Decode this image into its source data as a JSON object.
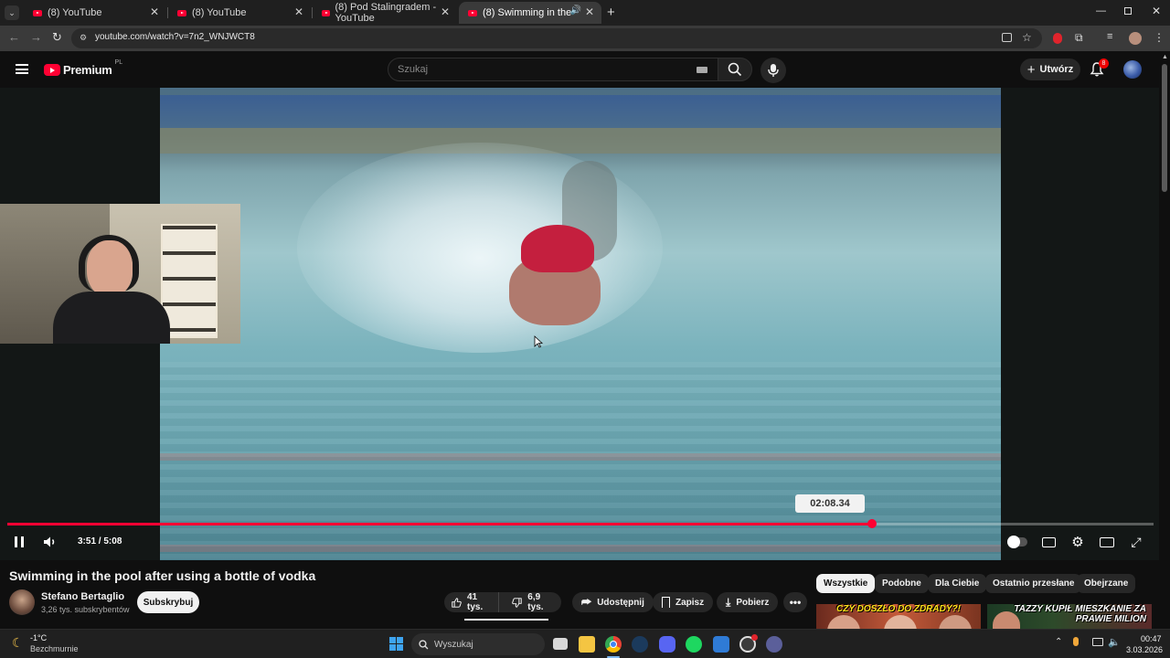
{
  "browser": {
    "tabs": [
      {
        "title": "(8) YouTube",
        "active": false
      },
      {
        "title": "(8) YouTube",
        "active": false
      },
      {
        "title": "(8) Pod Stalingradem - YouTube",
        "active": false
      },
      {
        "title": "(8) Swimming in the pool af",
        "active": true
      }
    ],
    "url": "youtube.com/watch?v=7n2_WNJWCT8"
  },
  "youtube": {
    "logo_text": "Premium",
    "logo_region": "PL",
    "search_placeholder": "Szukaj",
    "create_label": "Utwórz",
    "notification_count": "8"
  },
  "player": {
    "progress": 0.7546,
    "current_time": "3:51",
    "time_separator": "/",
    "duration": "5:08",
    "video_timestamp": "02:08.34"
  },
  "video": {
    "title": "Swimming in the pool after using a bottle of vodka",
    "channel_name": "Stefano Bertaglio",
    "subscribers": "3,26 tys. subskrybentów",
    "subscribe_label": "Subskrybuj",
    "likes": "41 tys.",
    "dislikes": "6,9 tys.",
    "share_label": "Udostępnij",
    "save_label": "Zapisz",
    "download_label": "Pobierz"
  },
  "chips": [
    "Wszystkie",
    "Podobne",
    "Dla Ciebie",
    "Ostatnio przesłane",
    "Obejrzane"
  ],
  "recommendations": [
    {
      "thumb_text": "CZY DOSZŁO DO ZDRADY?!"
    },
    {
      "thumb_text": "TAZZY KUPIŁ MIESZKANIE ZA PRAWIE MILION"
    }
  ],
  "taskbar": {
    "weather_temp": "-1°C",
    "weather_desc": "Bezchmurnie",
    "search_placeholder": "Wyszukaj",
    "time": "00:47",
    "date": "3.03.2026"
  }
}
